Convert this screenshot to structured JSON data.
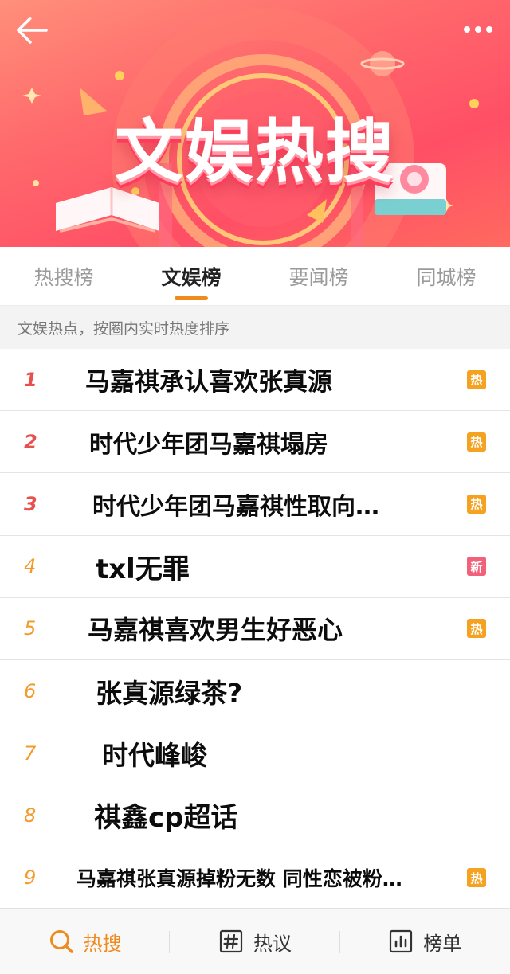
{
  "banner": {
    "title": "文娱热搜",
    "colors": {
      "gradient_start": "#ff8f7a",
      "gradient_end": "#ff4f66",
      "title_shadow": "#ff3b5c"
    },
    "back_icon": "back-arrow-icon",
    "more_icon": "more-dots-icon"
  },
  "tabs": [
    {
      "label": "热搜榜",
      "active": false
    },
    {
      "label": "文娱榜",
      "active": true
    },
    {
      "label": "要闻榜",
      "active": false
    },
    {
      "label": "同城榜",
      "active": false
    }
  ],
  "subheader": "文娱热点，按圈内实时热度排序",
  "list": [
    {
      "rank": "1",
      "title": "马嘉祺承认喜欢张真源",
      "badge": "热"
    },
    {
      "rank": "2",
      "title": "时代少年团马嘉祺塌房",
      "badge": "热"
    },
    {
      "rank": "3",
      "title": "时代少年团马嘉祺性取向…",
      "badge": "热"
    },
    {
      "rank": "4",
      "title": "txl无罪",
      "badge": "新"
    },
    {
      "rank": "5",
      "title": "马嘉祺喜欢男生好恶心",
      "badge": "热"
    },
    {
      "rank": "6",
      "title": "张真源绿茶?",
      "badge": ""
    },
    {
      "rank": "7",
      "title": "时代峰峻",
      "badge": ""
    },
    {
      "rank": "8",
      "title": "祺鑫cp超话",
      "badge": ""
    },
    {
      "rank": "9",
      "title": "马嘉祺张真源掉粉无数 同性恋被粉…",
      "badge": "热"
    }
  ],
  "bottom_nav": [
    {
      "label": "热搜",
      "icon": "search-icon",
      "active": true
    },
    {
      "label": "热议",
      "icon": "hashtag-icon",
      "active": false
    },
    {
      "label": "榜单",
      "icon": "chart-icon",
      "active": false
    }
  ],
  "colors": {
    "accent": "#f08a1c",
    "hot_badge": "#f6a221",
    "new_badge": "#f2617a",
    "rank_top": "#e8504e",
    "rank_rest": "#f39a2a"
  }
}
